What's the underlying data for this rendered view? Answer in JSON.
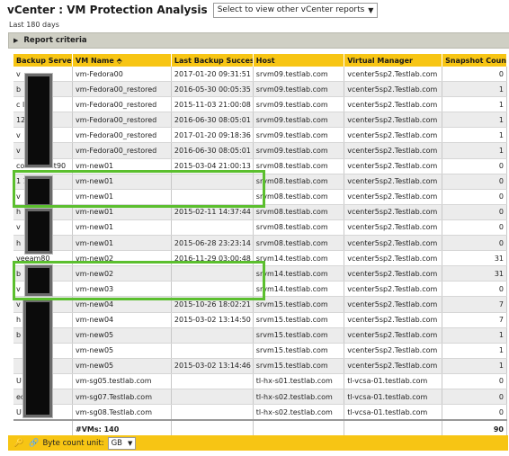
{
  "header": {
    "title": "vCenter : VM Protection Analysis",
    "report_select": "Select to view other vCenter reports",
    "subtitle": "Last 180 days",
    "criteria_label": "Report criteria"
  },
  "table": {
    "columns": [
      "Backup Server",
      "VM Name ⬘",
      "Last Backup Success",
      "Host",
      "Virtual Manager",
      "Snapshot Count"
    ],
    "rows": [
      [
        "v",
        "vm-Fedora00",
        "2017-01-20 09:31:51",
        "srvm09.testlab.com",
        "vcenter5sp2.Testlab.com",
        "0"
      ],
      [
        "b",
        "vm-Fedora00_restored",
        "2016-05-30 00:05:35",
        "srvm09.testlab.com",
        "vcenter5sp2.Testlab.com",
        "1"
      ],
      [
        "c    lt90",
        "vm-Fedora00_restored",
        "2015-11-03 21:00:08",
        "srvm09.testlab.com",
        "vcenter5sp2.Testlab.com",
        "1"
      ],
      [
        "      123",
        "vm-Fedora00_restored",
        "2016-06-30 08:05:01",
        "srvm09.testlab.com",
        "vcenter5sp2.Testlab.com",
        "1"
      ],
      [
        "v",
        "vm-Fedora00_restored",
        "2017-01-20 09:18:36",
        "srvm09.testlab.com",
        "vcenter5sp2.Testlab.com",
        "1"
      ],
      [
        "v",
        "vm-Fedora00_restored",
        "2016-06-30 08:05:01",
        "srvm09.testlab.com",
        "vcenter5sp2.Testlab.com",
        "1"
      ],
      [
        "commvault90",
        "vm-new01",
        "2015-03-04 21:00:13",
        "srvm08.testlab.com",
        "vcenter5sp2.Testlab.com",
        "0"
      ],
      [
        "1      123",
        "vm-new01",
        "",
        "srvm08.testlab.com",
        "vcenter5sp2.Testlab.com",
        "0"
      ],
      [
        "v",
        "vm-new01",
        "",
        "srvm08.testlab.com",
        "vcenter5sp2.Testlab.com",
        "0"
      ],
      [
        "h",
        "vm-new01",
        "2015-02-11 14:37:44",
        "srvm08.testlab.com",
        "vcenter5sp2.Testlab.com",
        "0"
      ],
      [
        "v",
        "vm-new01",
        "",
        "srvm08.testlab.com",
        "vcenter5sp2.Testlab.com",
        "0"
      ],
      [
        "h",
        "vm-new01",
        "2015-06-28 23:23:14",
        "srvm08.testlab.com",
        "vcenter5sp2.Testlab.com",
        "0"
      ],
      [
        "veeam80",
        "vm-new02",
        "2016-11-29 03:00:48",
        "srvm14.testlab.com",
        "vcenter5sp2.Testlab.com",
        "31"
      ],
      [
        "b",
        "vm-new02",
        "",
        "srvm14.testlab.com",
        "vcenter5sp2.Testlab.com",
        "31"
      ],
      [
        "v",
        "vm-new03",
        "",
        "srvm14.testlab.com",
        "vcenter5sp2.Testlab.com",
        "0"
      ],
      [
        "v",
        "vm-new04",
        "2015-10-26 18:02:21",
        "srvm15.testlab.com",
        "vcenter5sp2.Testlab.com",
        "7"
      ],
      [
        "h",
        "vm-new04",
        "2015-03-02 13:14:50",
        "srvm15.testlab.com",
        "vcenter5sp2.Testlab.com",
        "7"
      ],
      [
        "b",
        "vm-new05",
        "",
        "srvm15.testlab.com",
        "vcenter5sp2.Testlab.com",
        "1"
      ],
      [
        "",
        "vm-new05",
        "",
        "srvm15.testlab.com",
        "vcenter5sp2.Testlab.com",
        "1"
      ],
      [
        "",
        "vm-new05",
        "2015-03-02 13:14:46",
        "srvm15.testlab.com",
        "vcenter5sp2.Testlab.com",
        "1"
      ],
      [
        "U      ed",
        "vm-sg05.testlab.com",
        "",
        "tl-hx-s01.testlab.com",
        "tl-vcsa-01.testlab.com",
        "0"
      ],
      [
        "      ed",
        "vm-sg07.Testlab.com",
        "",
        "tl-hx-s02.testlab.com",
        "tl-vcsa-01.testlab.com",
        "0"
      ],
      [
        "U",
        "vm-sg08.Testlab.com",
        "",
        "tl-hx-s02.testlab.com",
        "tl-vcsa-01.testlab.com",
        "0"
      ]
    ],
    "total_label": "#VMs: 140",
    "total_snapshots": "90"
  },
  "footer": {
    "unit_label": "Byte count unit:",
    "unit_value": "GB"
  },
  "colors": {
    "header_yellow": "#f7c514",
    "highlight_green": "#5bbf2e",
    "criteria_gray": "#cfcfc4"
  }
}
